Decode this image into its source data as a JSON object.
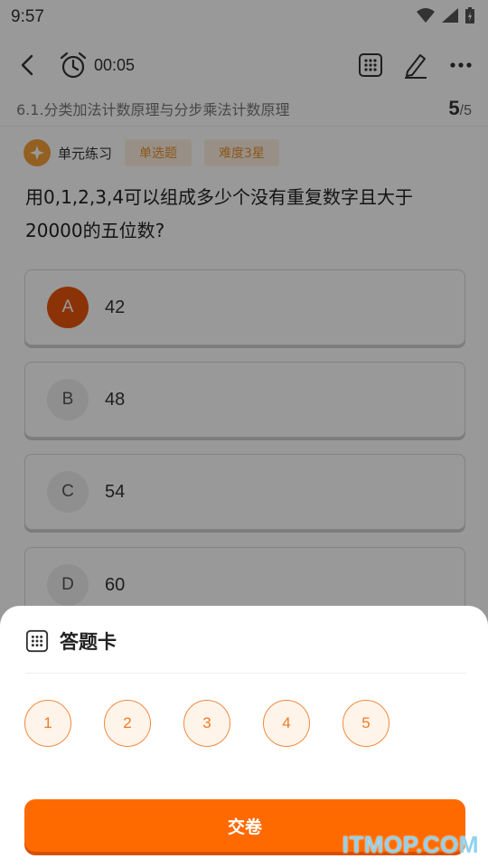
{
  "status_bar": {
    "time": "9:57",
    "icons": [
      "wifi-icon",
      "signal-icon",
      "battery-charging-icon"
    ]
  },
  "nav": {
    "timer": "00:05",
    "icons": [
      "back-icon",
      "alarm-clock-icon",
      "answer-grid-icon",
      "edit-pen-icon",
      "more-icon"
    ]
  },
  "chapter": {
    "title": "6.1.分类加法计数原理与分步乘法计数原理",
    "current": "5",
    "total": "/5"
  },
  "tags": {
    "unit": "单元练习",
    "type": "单选题",
    "difficulty": "难度3星"
  },
  "question": {
    "text": "用0,1,2,3,4可以组成多少个没有重复数字且大于20000的五位数?"
  },
  "options": [
    {
      "letter": "A",
      "text": "42",
      "selected": true
    },
    {
      "letter": "B",
      "text": "48",
      "selected": false
    },
    {
      "letter": "C",
      "text": "54",
      "selected": false
    },
    {
      "letter": "D",
      "text": "60",
      "selected": false
    }
  ],
  "answer_sheet": {
    "title": "答题卡",
    "numbers": [
      "1",
      "2",
      "3",
      "4",
      "5"
    ],
    "submit_label": "交卷"
  },
  "colors": {
    "accent": "#ff6a00",
    "selected": "#e8560c",
    "tag_text": "#e8912e",
    "tag_bg": "#fdf1e2"
  },
  "watermark": "ITMOP.COM"
}
